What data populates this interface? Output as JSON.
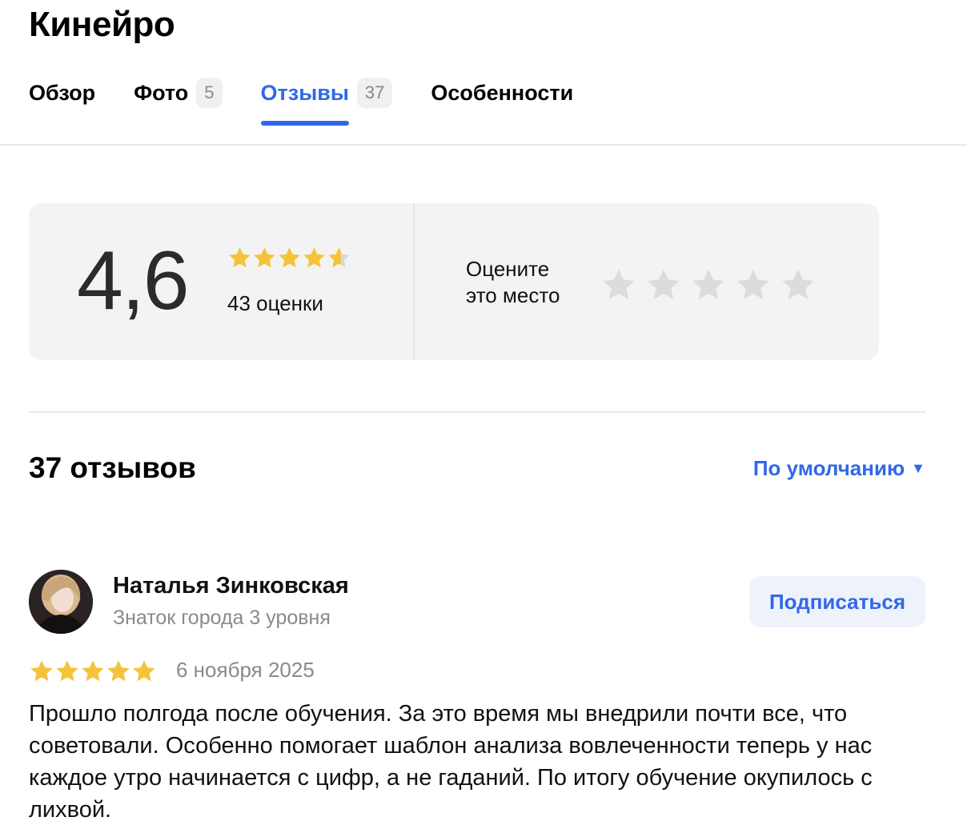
{
  "place": {
    "title": "Кинейро"
  },
  "tabs": [
    {
      "label": "Обзор",
      "count": null,
      "active": false
    },
    {
      "label": "Фото",
      "count": "5",
      "active": false
    },
    {
      "label": "Отзывы",
      "count": "37",
      "active": true
    },
    {
      "label": "Особенности",
      "count": null,
      "active": false
    }
  ],
  "rating": {
    "value": "4,6",
    "stars_filled": 4.6,
    "count_label": "43 оценки",
    "rate_prompt_line1": "Оцените",
    "rate_prompt_line2": "это место",
    "rate_stars_total": 5
  },
  "reviews": {
    "heading": "37 отзывов",
    "sort_label": "По умолчанию",
    "items": [
      {
        "author": "Наталья Зинковская",
        "level": "Знаток города 3 уровня",
        "subscribe_label": "Подписаться",
        "stars": 5,
        "date": "6 ноября 2025",
        "text": "Прошло полгода после обучения. За это время мы внедрили почти все, что советовали. Особенно помогает шаблон анализа вовлеченности теперь у нас каждое утро начинается с цифр, а не гаданий. По итогу обучение окупилось с лихвой."
      }
    ]
  },
  "colors": {
    "accent": "#3068e8",
    "star_gold": "#f5c33b",
    "star_empty": "#d8d8d8",
    "card_bg": "#f3f3f3"
  },
  "icons": {
    "star": "star-icon",
    "caret": "caret-down-icon"
  }
}
